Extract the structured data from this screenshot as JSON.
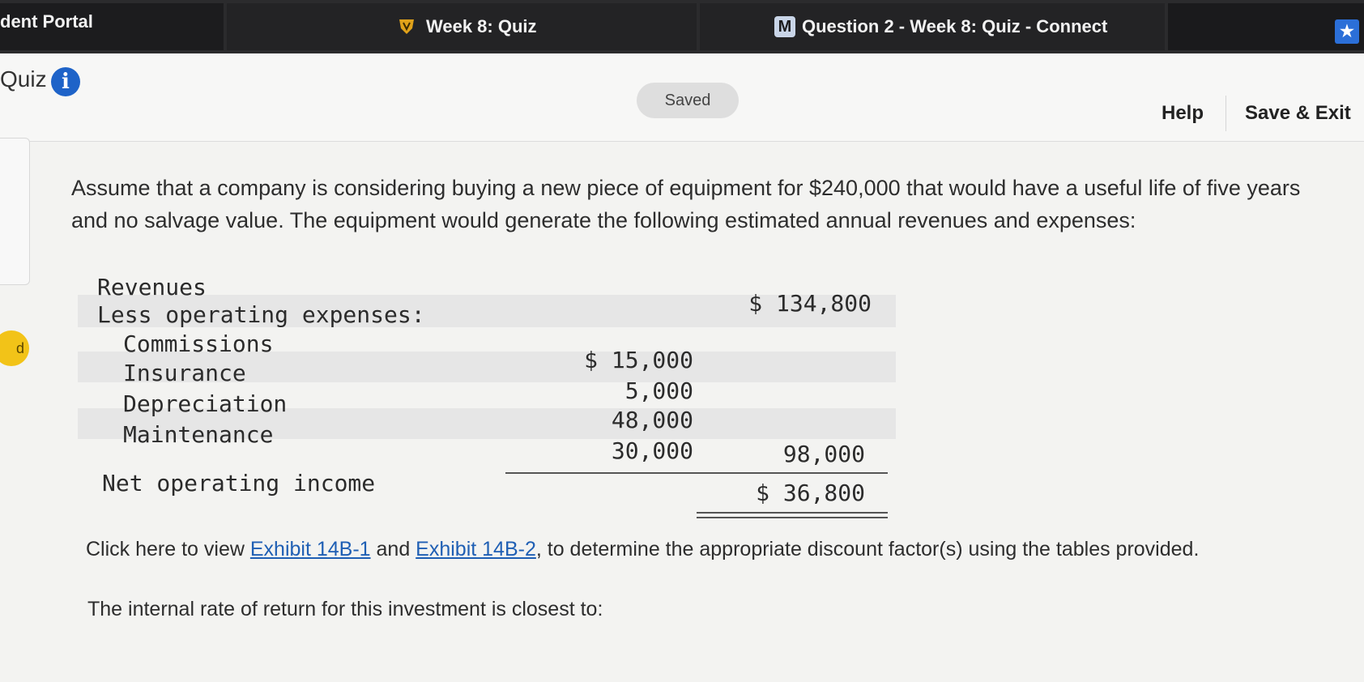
{
  "tabs": [
    {
      "label": "dent Portal"
    },
    {
      "label": "Week 8: Quiz"
    },
    {
      "label": "Question 2 - Week 8: Quiz - Connect",
      "badge": "M"
    }
  ],
  "star_icon": "★",
  "header": {
    "title": "Quiz",
    "info_icon": "i",
    "saved": "Saved",
    "help": "Help",
    "save_exit": "Save & Exit"
  },
  "side_indicator": "d",
  "question": {
    "intro": "Assume that a company is considering buying a new piece of equipment for $240,000 that would have a useful life of five years and no salvage value. The equipment would generate the following estimated annual revenues and expenses:",
    "table": {
      "revenues_label": "Revenues",
      "revenues_value": "$ 134,800",
      "less_label": "Less operating expenses:",
      "expenses": [
        {
          "label": "Commissions",
          "value": "$ 15,000"
        },
        {
          "label": "Insurance",
          "value": "5,000"
        },
        {
          "label": "Depreciation",
          "value": "48,000"
        },
        {
          "label": "Maintenance",
          "value": "30,000"
        }
      ],
      "total_expenses": "98,000",
      "noi_label": "Net operating income",
      "noi_value": "$ 36,800"
    },
    "link_prefix": "Click here to view ",
    "exhibit1": "Exhibit 14B-1",
    "link_mid": " and ",
    "exhibit2": "Exhibit 14B-2",
    "link_suffix": ", to determine the appropriate discount factor(s) using the tables provided.",
    "prompt": "The internal rate of return for this investment is closest to:"
  }
}
